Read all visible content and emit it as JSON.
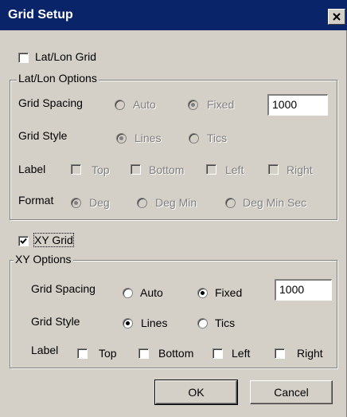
{
  "window": {
    "title": "Grid Setup"
  },
  "latlon": {
    "checkbox_label": "Lat/Lon Grid",
    "group_label": "Lat/Lon Options",
    "grid_spacing": {
      "label": "Grid Spacing",
      "auto": "Auto",
      "fixed": "Fixed",
      "value": "1000"
    },
    "grid_style": {
      "label": "Grid Style",
      "lines": "Lines",
      "tics": "Tics"
    },
    "label_row": {
      "label": "Label",
      "top": "Top",
      "bottom": "Bottom",
      "left": "Left",
      "right": "Right"
    },
    "format": {
      "label": "Format",
      "deg": "Deg",
      "deg_min": "Deg Min",
      "deg_min_sec": "Deg Min Sec"
    }
  },
  "xy": {
    "checkbox_label": "XY Grid",
    "group_label": "XY Options",
    "grid_spacing": {
      "label": "Grid Spacing",
      "auto": "Auto",
      "fixed": "Fixed",
      "value": "1000"
    },
    "grid_style": {
      "label": "Grid Style",
      "lines": "Lines",
      "tics": "Tics"
    },
    "label_row": {
      "label": "Label",
      "top": "Top",
      "bottom": "Bottom",
      "left": "Left",
      "right": "Right"
    }
  },
  "buttons": {
    "ok": "OK",
    "cancel": "Cancel"
  },
  "colors": {
    "titlebar": "#0a246a",
    "face": "#d4d0c8"
  },
  "icons": [
    "close-icon",
    "checkmark-icon"
  ]
}
